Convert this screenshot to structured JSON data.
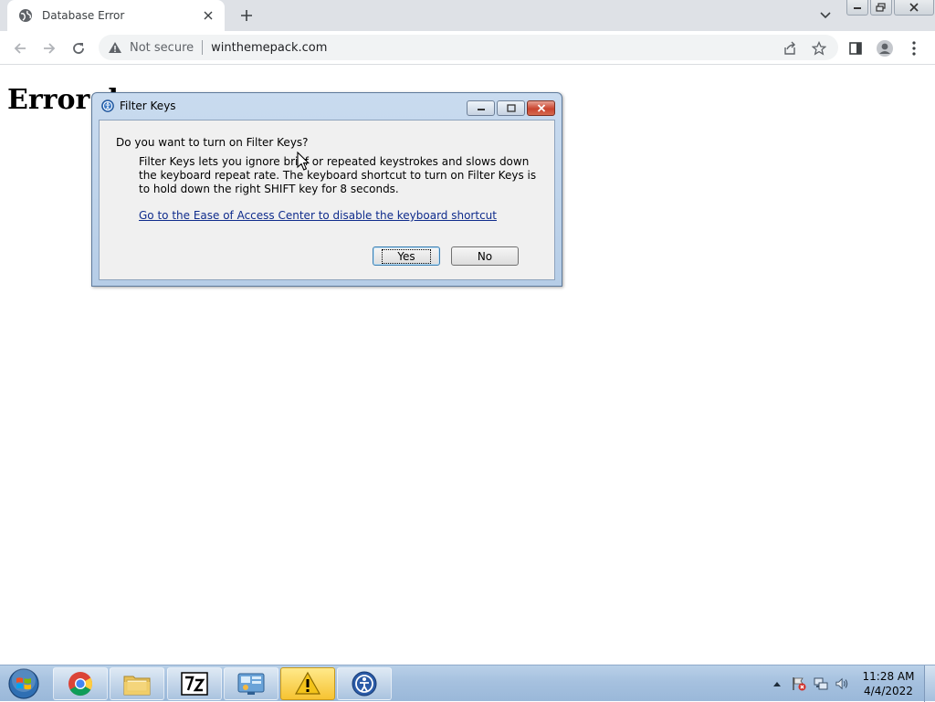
{
  "browser": {
    "tab": {
      "title": "Database Error"
    },
    "address_bar": {
      "security_label": "Not secure",
      "url": "winthemepack.com"
    }
  },
  "page": {
    "heading": "Error d"
  },
  "dialog": {
    "title": "Filter Keys",
    "question": "Do you want to turn on Filter Keys?",
    "description": "Filter Keys lets you ignore brief or repeated keystrokes and slows down the keyboard repeat rate.  The keyboard shortcut to turn on Filter Keys is to hold down the right SHIFT key for 8 seconds.",
    "link": "Go to the Ease of Access Center to disable the keyboard shortcut",
    "yes_label": "Yes",
    "no_label": "No"
  },
  "taskbar": {
    "items": [
      "start-orb",
      "chrome",
      "file-explorer",
      "7zip",
      "control-panel",
      "warning",
      "winaero-tool"
    ],
    "clock": {
      "time": "11:28 AM",
      "date": "4/4/2022"
    }
  },
  "colors": {
    "link": "#0f2c8c",
    "warn_task": "#f6c332",
    "taskbar": "#a6c1df"
  }
}
